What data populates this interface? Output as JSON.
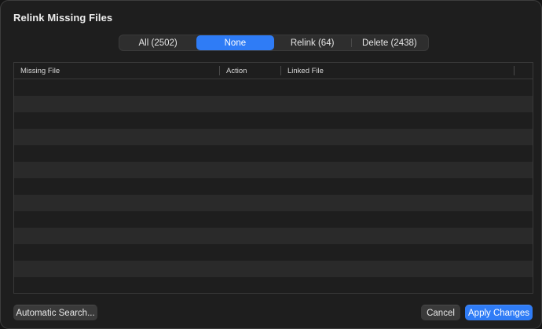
{
  "dialog": {
    "title": "Relink Missing Files"
  },
  "filter": {
    "options": [
      {
        "label": "All (2502)",
        "selected": false
      },
      {
        "label": "None",
        "selected": true
      },
      {
        "label": "Relink (64)",
        "selected": false
      },
      {
        "label": "Delete (2438)",
        "selected": false
      }
    ]
  },
  "table": {
    "columns": [
      "Missing File",
      "Action",
      "Linked File",
      ""
    ],
    "rows": []
  },
  "buttons": {
    "automatic_search": "Automatic Search...",
    "cancel": "Cancel",
    "apply": "Apply Changes"
  },
  "colors": {
    "accent": "#2f7cf6",
    "background": "#1e1e1e",
    "row_alt": "#2a2a2a"
  }
}
